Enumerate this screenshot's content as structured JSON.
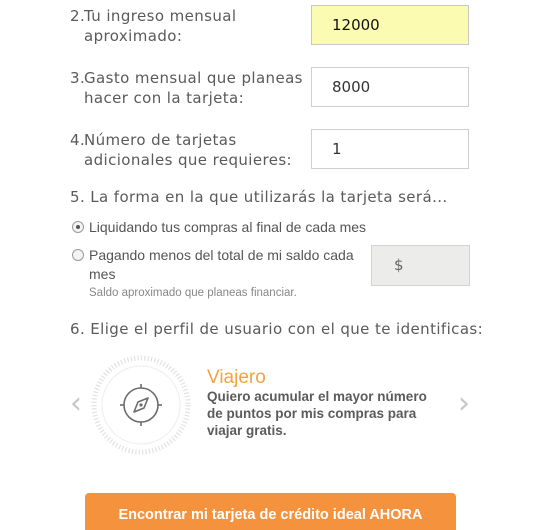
{
  "questions": [
    {
      "num": "2.",
      "line1": "Tu ingreso mensual",
      "line2": "aproximado:",
      "value": "12000"
    },
    {
      "num": "3.",
      "line1": "Gasto mensual que planeas",
      "line2": "hacer con la tarjeta:",
      "value": "8000"
    },
    {
      "num": "4.",
      "line1": "Número de tarjetas",
      "line2": "adicionales que requieres:",
      "value": "1"
    }
  ],
  "usage": {
    "heading": "5. La forma en la que utilizarás la tarjeta será...",
    "option1": "Liquidando tus compras al final de cada mes",
    "option2_line1": "Pagando menos del total de mi saldo cada",
    "option2_line2": "mes",
    "amount_placeholder": "$",
    "hint": "Saldo aproximado que planeas financiar."
  },
  "profile": {
    "heading": "6. Elige el perfil de usuario con el que te identificas:",
    "title": "Viajero",
    "description": "Quiero acumular el mayor número de puntos por mis compras para viajar gratis.",
    "prev_arrow": "‹",
    "next_arrow": "›",
    "icon": "compass-icon"
  },
  "cta_label": "Encontrar mi tarjeta de crédito ideal AHORA",
  "colors": {
    "accent": "#f5923e",
    "highlight": "#fbfbb1",
    "title": "#f4a340"
  }
}
